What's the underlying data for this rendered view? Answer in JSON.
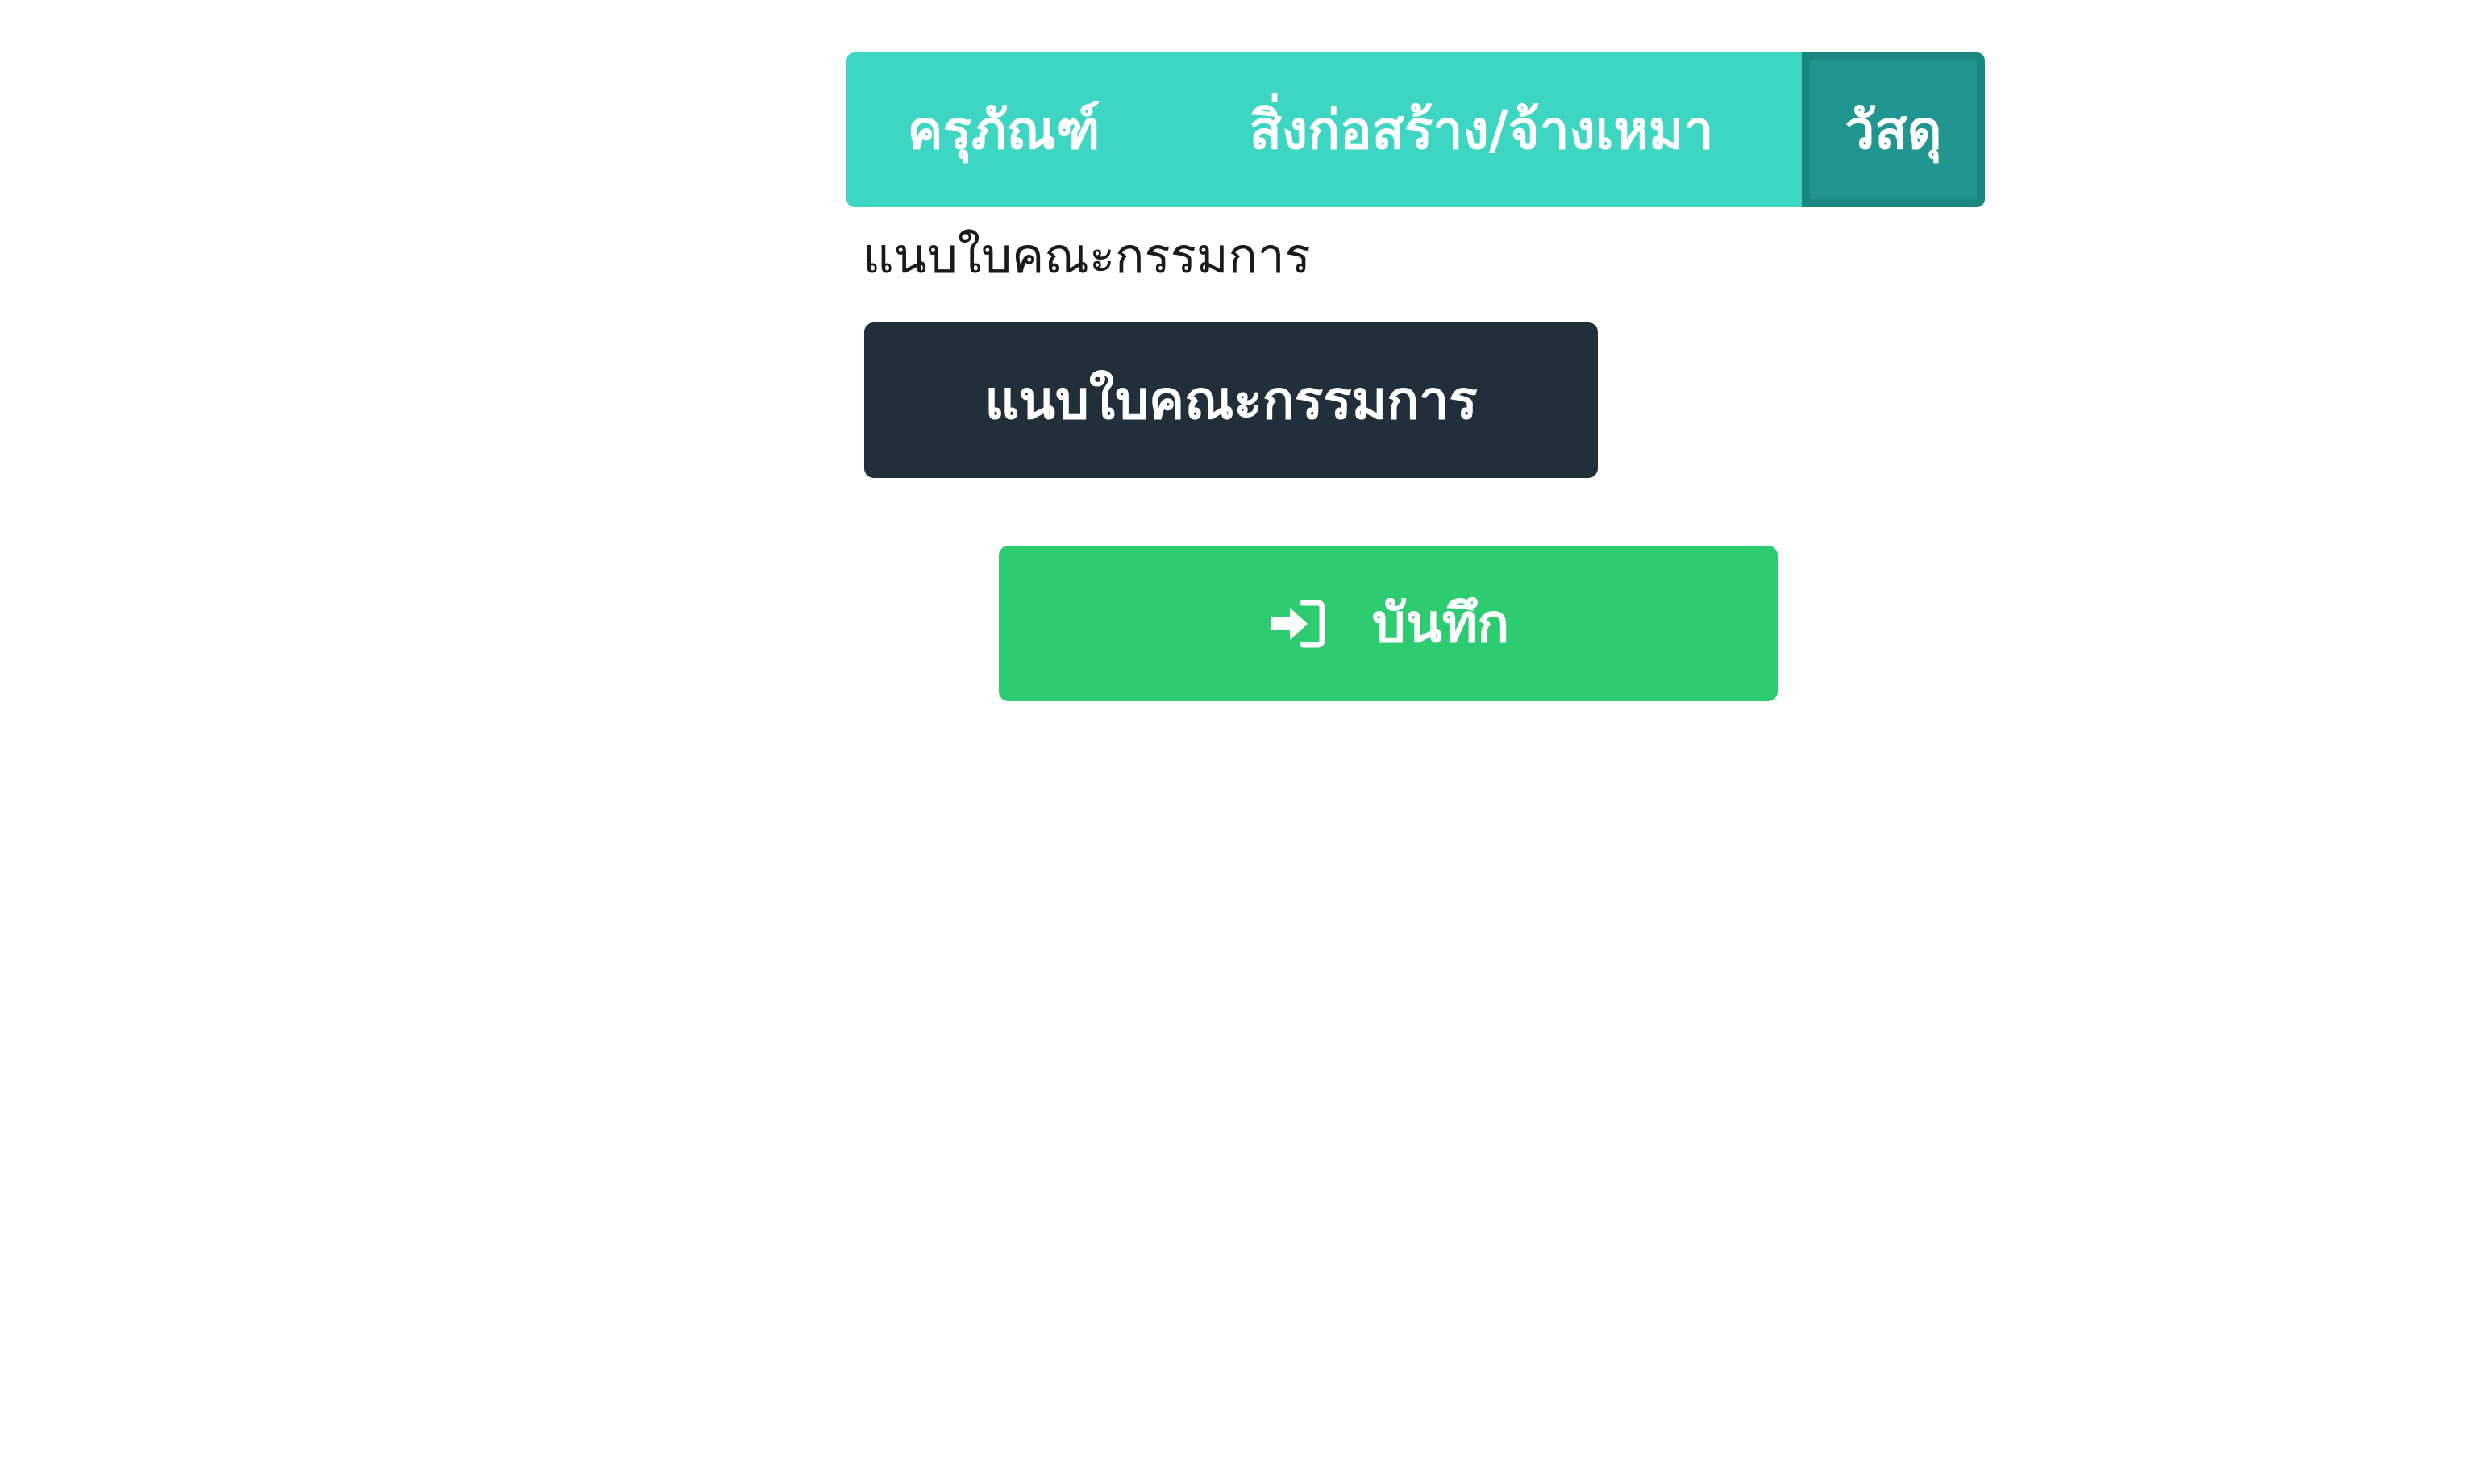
{
  "tabs": [
    {
      "label": "ครุภัณฑ์",
      "active": false
    },
    {
      "label": "สิ่งก่อสร้าง/จ้างเหมา",
      "active": false
    },
    {
      "label": "วัสดุ",
      "active": true
    }
  ],
  "attachment": {
    "section_label": "แนบใบคณะกรรมการ",
    "button_label": "แนบใบคณะกรรมการ"
  },
  "save": {
    "label": "บันทึก",
    "icon": "sign-in-icon"
  },
  "colors": {
    "tab_bar": "#3dd6c2",
    "tab_active": "#219590",
    "attach_button": "#212f3a",
    "save_button": "#2ecc71"
  }
}
